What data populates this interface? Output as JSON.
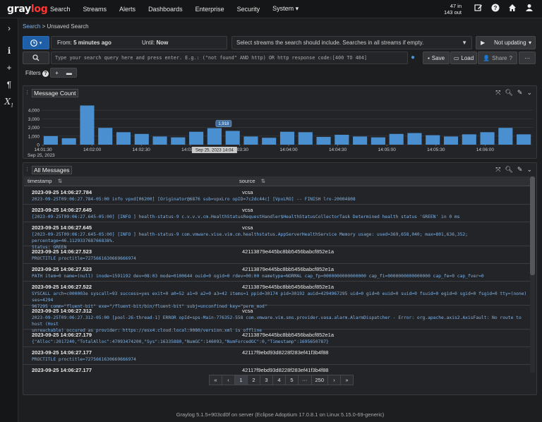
{
  "brand": {
    "name_prefix": "gray",
    "name_suffix": "log"
  },
  "nav": {
    "items": [
      "Search",
      "Streams",
      "Alerts",
      "Dashboards",
      "Enterprise",
      "Security",
      "System"
    ],
    "system_caret": "▾",
    "throughput_in": "47 in",
    "throughput_out": "143 out"
  },
  "breadcrumb": {
    "root": "Search",
    "separator": " > ",
    "current": "Unsaved Search"
  },
  "search_bar": {
    "time_from_label": "From:",
    "time_from_value": "5 minutes ago",
    "time_until_label": "Until:",
    "time_until_value": "Now",
    "streams_placeholder": "Select streams the search should include. Searches in all streams if empty.",
    "update_label": "Not updating",
    "query_placeholder": "Type your search query here and press enter. E.g.: (\"not found\" AND http) OR http response code:[400 TO 404]",
    "save_label": "Save",
    "load_label": "Load",
    "share_label": "Share",
    "more_label": "···",
    "filters_label": "Filters"
  },
  "message_count": {
    "title": "Message Count",
    "tooltip_value": "1,918",
    "hover_timestamp": "Sep 25, 2023 14:04"
  },
  "chart_data": {
    "type": "bar",
    "title": "Message Count",
    "ylim": [
      0,
      5000
    ],
    "y_ticks": [
      0,
      1000,
      2000,
      3000,
      4000
    ],
    "y_tick_labels": [
      "0",
      "1,000",
      "2,000",
      "3,000",
      "4,000"
    ],
    "x_tick_labels": [
      "14:01:30",
      "14:02:00",
      "14:02:30",
      "14:03:00",
      "14:03:30",
      "14:04:00",
      "14:04:30",
      "14:05:00",
      "14:05:30",
      "14:06:00"
    ],
    "x_date_label": "Sep 25, 2023",
    "values": [
      1000,
      750,
      4550,
      1950,
      1450,
      1250,
      950,
      850,
      1500,
      1918,
      1600,
      950,
      800,
      1500,
      1450,
      900,
      1150,
      950,
      850,
      1250,
      1350,
      1100,
      950,
      1200,
      1450,
      1950,
      1200
    ],
    "grid": true
  },
  "messages": {
    "title": "All Messages",
    "col_timestamp": "timestamp",
    "col_source": "source",
    "rows": [
      {
        "ts": "2023-09-25 14:06:27.784",
        "src": "vcsa",
        "msg": "2023-09-25T09:06:27.784-05:00 info vpxd[06200] [Originator@6876 sub=vpxLro opID=7c2dc44c] [VpxLRO] -- FINISH lro-20004808"
      },
      {
        "ts": "2023-09-25 14:06:27.645",
        "src": "vcsa",
        "msg": "[2023-09-25T09:06:27.645-05:00] [INFO ] health-status-9 c.v.v.v.cm.HealthStatusRequestHandler$HealthStatusCollectorTask Determined health status 'GREEN' in 0 ms"
      },
      {
        "ts": "2023-09-25 14:06:27.645",
        "src": "vcsa",
        "msg": "[2023-09-25T09:06:27.645-05:00] [INFO ] health-status-9 com.vmware.vise.vim.cm.healthstatus.AppServerHealthService Memory usage: used=369,658,040; max=801,636,352; percentage=46.112933768766838%.\nStatus: GREEN"
      },
      {
        "ts": "2023-09-25 14:06:27.523",
        "src": "42113879e445bc8bb5456babcf852e1a",
        "msg": "PROCTITLE proctitle=7275661630669666974"
      },
      {
        "ts": "2023-09-25 14:06:27.523",
        "src": "42113879e445bc8bb5456babcf852e1a",
        "msg": "PATH item=0 name=(null) inode=1591192 dev=08:03 mode=0100644 ouid=0 ogid=0 rdev=00:00 nametype=NORMAL cap_fp=0000000000000000 cap_fi=0000000000000000 cap_fe=0 cap_fver=0"
      },
      {
        "ts": "2023-09-25 14:06:27.522",
        "src": "42113879e445bc8bb5456babcf852e1a",
        "msg": "SYSCALL arch=c000003e syscall=93 success=yes exit=0 a0=52 a1=0 a2=0 a3=42 items=1 ppid=30174 pid=30192 auid=4294967295 uid=0 gid=0 euid=0 suid=0 fsuid=0 egid=0 sgid=0 fsgid=0 tty=(none) ses=4294\n967295 comm=\"fluent-bit\" exe=\"/fluent-bit/bin/fluent-bit\" subj=unconfined key=\"perm_mod\""
      },
      {
        "ts": "2023-09-25 14:06:27.312",
        "src": "vcsa",
        "msg": "2023-09-25T09:06:27.312-05:00 [pool-26-thread-1] ERROR opId=sps-Main-776352-558 com.vmware.vim.sms.provider.vasa.alarm.AlarmDispatcher - Error: org.apache.axis2.AxisFault: No route to host (Host\nunreachable) occured as provider: https://esx4.cloud.local:9080/version.xml is offline"
      },
      {
        "ts": "2023-09-25 14:06:27.179",
        "src": "42113879e445bc8bb5456babcf852e1a",
        "msg": "{\"Alloc\":2017240,\"TotalAlloc\":47093474200,\"Sys\":16335880,\"NumGC\":146093,\"NumForcedGC\":0,\"Timestamp\":1695650787}"
      },
      {
        "ts": "2023-09-25 14:06:27.177",
        "src": "42117f9ebd93d8228f283ef41f3b4f88",
        "msg": "PROCTITLE proctitle=7275661630669666974"
      },
      {
        "ts": "2023-09-25 14:06:27.177",
        "src": "42117f9ebd93d8228f283ef41f3b4f88",
        "msg": "PATH item=0 name=(null) inode=547361820 dev=00:0b mode=010600 ouid=0 ogid=0 rdev=00:00 nametype=NORMAL cap_fp=0000000000000000 cap_fi=0000000000000000 cap_fe=0 cap_fver=0"
      }
    ]
  },
  "pagination": {
    "first": "«",
    "prev": "‹",
    "pages": [
      "1",
      "2",
      "3",
      "4",
      "5"
    ],
    "ellipsis": "···",
    "last_page": "250",
    "next": "›",
    "last": "»"
  },
  "footer": {
    "text": "Graylog 5.1.5+903cd0f on server (Eclipse Adoptium 17.0.8.1 on Linux 5.15.0-69-generic)"
  },
  "colors": {
    "accent_blue": "#1f5fa8",
    "bar_blue": "#4a90d0",
    "link_blue": "#7fb2e6",
    "brand_red": "#ff3633"
  }
}
